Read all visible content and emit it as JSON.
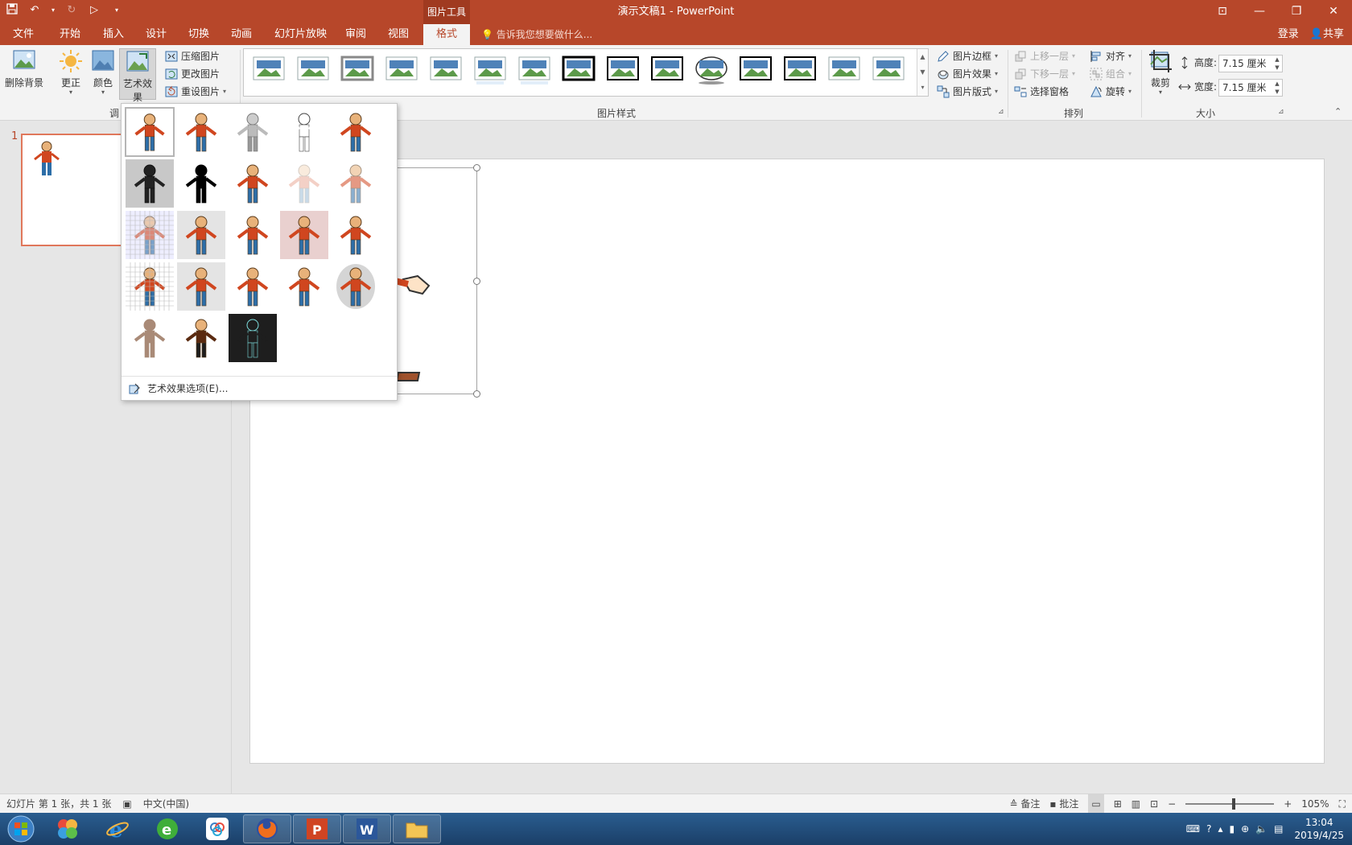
{
  "title_bar": {
    "context_tab_title": "图片工具",
    "document_title": "演示文稿1 - PowerPoint"
  },
  "tabs": [
    {
      "label": "文件"
    },
    {
      "label": "开始"
    },
    {
      "label": "插入"
    },
    {
      "label": "设计"
    },
    {
      "label": "切换"
    },
    {
      "label": "动画"
    },
    {
      "label": "幻灯片放映"
    },
    {
      "label": "审阅"
    },
    {
      "label": "视图"
    },
    {
      "label": "格式"
    }
  ],
  "tell_me": "告诉我您想要做什么...",
  "account": {
    "signin": "登录",
    "share": "共享"
  },
  "ribbon": {
    "adjust": {
      "remove_bg": "删除背景",
      "corrections": "更正",
      "color": "颜色",
      "artistic_effects": "艺术效果",
      "compress": "压缩图片",
      "change": "更改图片",
      "reset": "重设图片",
      "group_label": "调"
    },
    "styles": {
      "group_label": "图片样式",
      "border": "图片边框",
      "effects": "图片效果",
      "layout": "图片版式"
    },
    "arrange": {
      "group_label": "排列",
      "bring_forward": "上移一层",
      "send_backward": "下移一层",
      "selection_pane": "选择窗格",
      "align": "对齐",
      "group": "组合",
      "rotate": "旋转"
    },
    "size": {
      "group_label": "大小",
      "crop": "裁剪",
      "height_label": "高度:",
      "height_value": "7.15 厘米",
      "width_label": "宽度:",
      "width_value": "7.15 厘米"
    }
  },
  "thumbnail": {
    "number": "1"
  },
  "art_effects_menu": {
    "options_label": "艺术效果选项(E)...",
    "effects": [
      "无",
      "标记",
      "铅笔灰度",
      "铅笔素描",
      "线条图",
      "粉笔素描",
      "画图笔划",
      "画图刷",
      "发光散射",
      "虚化",
      "浅色屏幕",
      "水彩海绵",
      "胶片颗粒",
      "马赛克气泡",
      "玻璃",
      "水泥",
      "纹理化",
      "十字图案蚀刻",
      "蜡笔平滑",
      "塑封",
      "图样",
      "影印",
      "发光边缘"
    ]
  },
  "status_bar": {
    "slide_info": "幻灯片 第 1 张，共 1 张",
    "language": "中文(中国)",
    "notes": "备注",
    "comments": "批注",
    "zoom": "105%"
  },
  "taskbar": {
    "time": "13:04",
    "date": "2019/4/25"
  },
  "colors": {
    "accent": "#b7472a",
    "ribbon_bg": "#f3f3f3",
    "taskbar": "#1b3f68"
  }
}
